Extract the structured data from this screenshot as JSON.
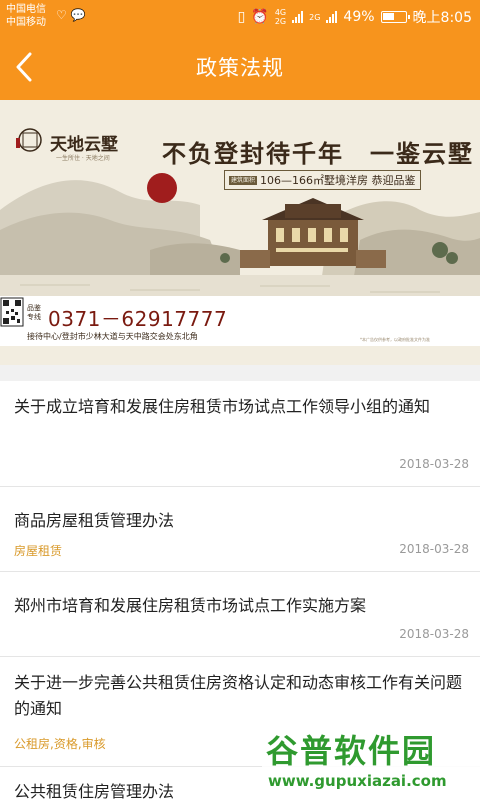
{
  "status_bar": {
    "carrier_1": "中国电信",
    "carrier_2": "中国移动",
    "network_top": "4G",
    "network_bottom": "2G",
    "network_2": "2G",
    "battery": "49%",
    "time": "晚上8:05"
  },
  "header": {
    "title": "政策法规",
    "back_icon": "chevron-left-icon"
  },
  "banner": {
    "brand": "天地云墅",
    "brand_sub": "一生所住 · 天地之间",
    "slogan": "不负登封待千年　一鉴云墅",
    "size_tag": "建筑面积",
    "size_text": "106—166㎡墅境洋房 恭迎品鉴",
    "phone_tag": "品鉴专线",
    "phone": "0371－62917777",
    "address": "接待中心/登封市少林大道与天中路交会处东北角",
    "disclaimer": "*本广告仅供参考，以政府批准文件为准"
  },
  "articles": [
    {
      "title": "关于成立培育和发展住房租赁市场试点工作领导小组的通知",
      "tag": "",
      "date": "2018-03-28"
    },
    {
      "title": "商品房屋租赁管理办法",
      "tag": "房屋租赁",
      "date": "2018-03-28"
    },
    {
      "title": "郑州市培育和发展住房租赁市场试点工作实施方案",
      "tag": "",
      "date": "2018-03-28"
    },
    {
      "title": "关于进一步完善公共租赁住房资格认定和动态审核工作有关问题的通知",
      "tag": "公租房,资格,审核",
      "date": ""
    },
    {
      "title": "公共租赁住房管理办法",
      "tag": "",
      "date": ""
    }
  ],
  "watermark": {
    "text": "谷普软件园",
    "url": "www.gupuxiazai.com"
  },
  "colors": {
    "header_bg": "#f7941d",
    "tag": "#d99a2b",
    "date": "#9a9a9a"
  }
}
